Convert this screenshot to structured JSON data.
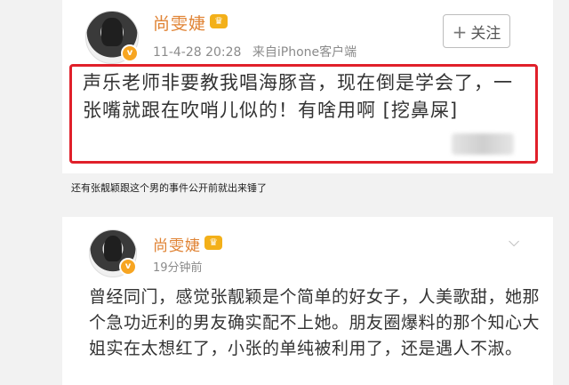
{
  "post1": {
    "author": "尚雯婕",
    "vip_badge": "♛",
    "verified_badge": "v",
    "timestamp": "11-4-28 20:28",
    "source": "来自iPhone客户端",
    "follow_label": "关注",
    "text": "声乐老师非要教我唱海豚音，现在倒是学会了，一张嘴就跟在吹哨儿似的！有啥用啊 [挖鼻屎]"
  },
  "caption": "还有张靓颖跟这个男的事件公开前就出来锤了",
  "post2": {
    "author": "尚雯婕",
    "vip_badge": "♛",
    "verified_badge": "v",
    "timestamp": "19分钟前",
    "text": "曾经同门，感觉张靓颖是个简单的好女子，人美歌甜，她那个急功近利的男友确实配不上她。朋友圈爆料的那个知心大姐实在太想红了，小张的单纯被利用了，还是遇人不淑。"
  },
  "colors": {
    "name": "#e08334",
    "highlight": "#e0202a",
    "vip": "#f3b019"
  }
}
